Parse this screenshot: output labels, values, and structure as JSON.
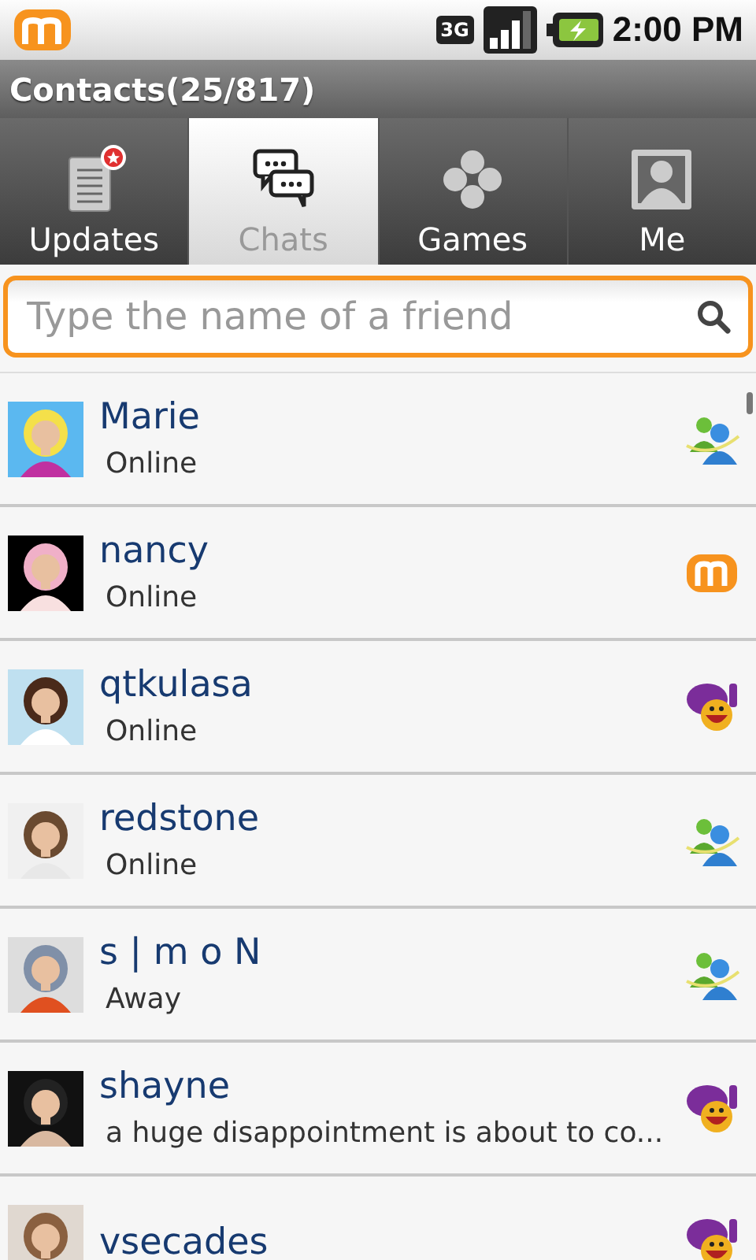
{
  "status_bar": {
    "time": "2:00 PM",
    "network": "3G"
  },
  "title_bar": {
    "title": "Contacts(25/817)"
  },
  "tabs": [
    {
      "label": "Updates",
      "kind": "updates",
      "selected": false
    },
    {
      "label": "Chats",
      "kind": "chats",
      "selected": true
    },
    {
      "label": "Games",
      "kind": "games",
      "selected": false
    },
    {
      "label": "Me",
      "kind": "me",
      "selected": false
    }
  ],
  "search": {
    "placeholder": "Type the name of a friend"
  },
  "contacts": [
    {
      "name": "Marie",
      "status": "Online",
      "kind": "buddies"
    },
    {
      "name": "nancy",
      "status": "Online",
      "kind": "logo"
    },
    {
      "name": "qtkulasa",
      "status": "Online",
      "kind": "smiley"
    },
    {
      "name": "redstone",
      "status": "Online",
      "kind": "buddies"
    },
    {
      "name": "s | m o N",
      "status": "Away",
      "kind": "buddies"
    },
    {
      "name": "shayne",
      "status": "a huge disappointment is about to co...",
      "kind": "smiley"
    },
    {
      "name": "vsecades",
      "kind": "smiley"
    }
  ]
}
